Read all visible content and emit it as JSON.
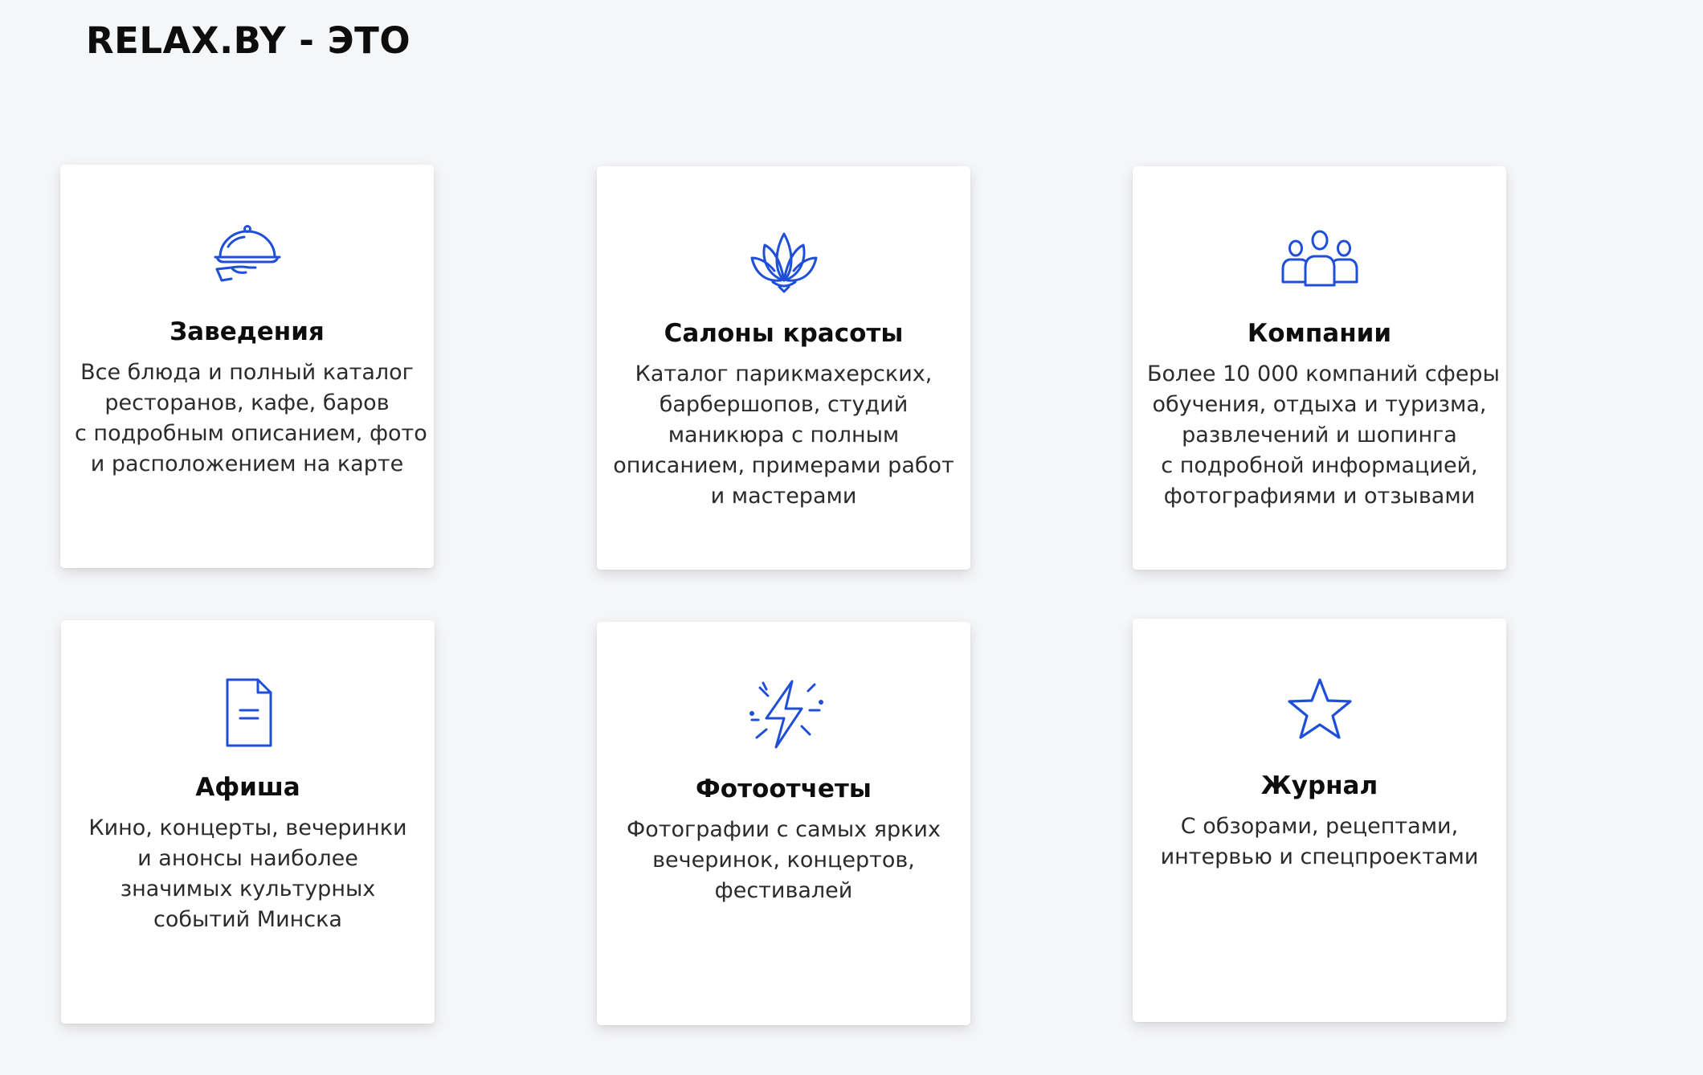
{
  "page": {
    "title": "RELAX.BY - ЭТО",
    "accent_color": "#1f4fd8",
    "background_color": "#f5f6f8"
  },
  "cards": [
    {
      "icon": "cloche-serving-icon",
      "title": "Заведения",
      "desc": [
        "Все блюда и полный каталог",
        "ресторанов, кафе, баров",
        "с подробным описанием, фото",
        "и расположением на карте"
      ]
    },
    {
      "icon": "lotus-icon",
      "title": "Салоны красоты",
      "desc": [
        "Каталог парикмахерских,",
        "барбершопов, студий",
        "маникюра с полным",
        "описанием, примерами работ",
        "и мастерами"
      ]
    },
    {
      "icon": "people-group-icon",
      "title": "Компании",
      "desc": [
        "Более 10 000 компаний сферы",
        "обучения, отдыха и туризма,",
        "развлечений и шопинга",
        "с подробной информацией,",
        "фотографиями и отзывами"
      ]
    },
    {
      "icon": "document-icon",
      "title": "Афиша",
      "desc": [
        "Кино, концерты, вечеринки",
        "и анонсы наиболее",
        "значимых культурных",
        "событий Минска"
      ]
    },
    {
      "icon": "lightning-flash-icon",
      "title": "Фотоотчеты",
      "desc": [
        "Фотографии с самых ярких",
        "вечеринок, концертов,",
        "фестивалей"
      ]
    },
    {
      "icon": "star-icon",
      "title": "Журнал",
      "desc": [
        "С обзорами, рецептами,",
        "интервью и спецпроектами"
      ]
    }
  ]
}
